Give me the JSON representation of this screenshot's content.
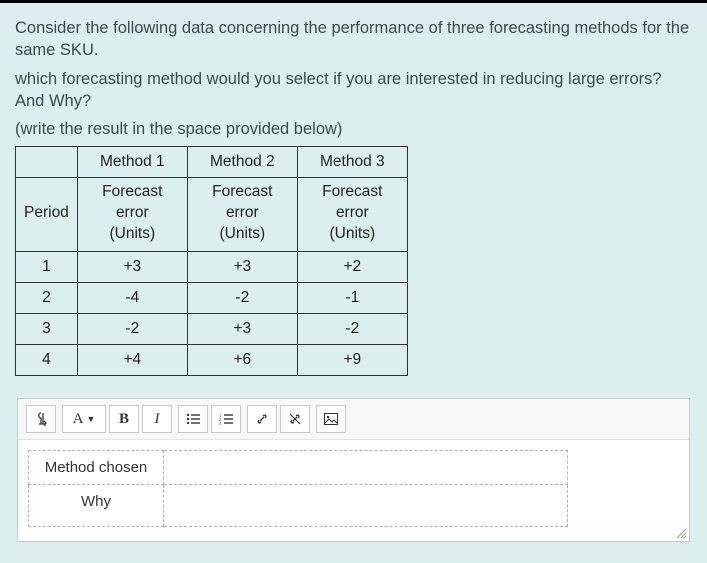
{
  "question": {
    "p1": "Consider the following data concerning the performance of three forecasting methods for the same SKU.",
    "p2": "which forecasting method would you select if you are interested in reducing large errors? And Why?",
    "p3": "(write the result in the space provided below)"
  },
  "table": {
    "headers": [
      "",
      "Method 1",
      "Method 2",
      "Method 3"
    ],
    "subheaders": {
      "period": "Period",
      "m1_l1": "Forecast error",
      "m1_l2": "(Units)",
      "m2_l1": "Forecast error",
      "m2_l2": "(Units)",
      "m3_l1": "Forecast error",
      "m3_l2": "(Units)"
    },
    "rows": [
      {
        "period": "1",
        "m1": "+3",
        "m2": "+3",
        "m3": "+2"
      },
      {
        "period": "2",
        "m1": "-4",
        "m2": "-2",
        "m3": "-1"
      },
      {
        "period": "3",
        "m1": "-2",
        "m2": "+3",
        "m3": "-2"
      },
      {
        "period": "4",
        "m1": "+4",
        "m2": "+6",
        "m3": "+9"
      }
    ]
  },
  "toolbar": {
    "font_label": "A",
    "bold": "B",
    "italic": "I"
  },
  "answer": {
    "method_label": "Method chosen",
    "why_label": "Why",
    "method_value": "",
    "why_value": ""
  },
  "chart_data": {
    "type": "table",
    "title": "Forecast error (Units) by Period and Method",
    "columns": [
      "Period",
      "Method 1",
      "Method 2",
      "Method 3"
    ],
    "rows": [
      [
        1,
        3,
        3,
        2
      ],
      [
        2,
        -4,
        -2,
        -1
      ],
      [
        3,
        -2,
        3,
        -2
      ],
      [
        4,
        4,
        6,
        9
      ]
    ]
  }
}
